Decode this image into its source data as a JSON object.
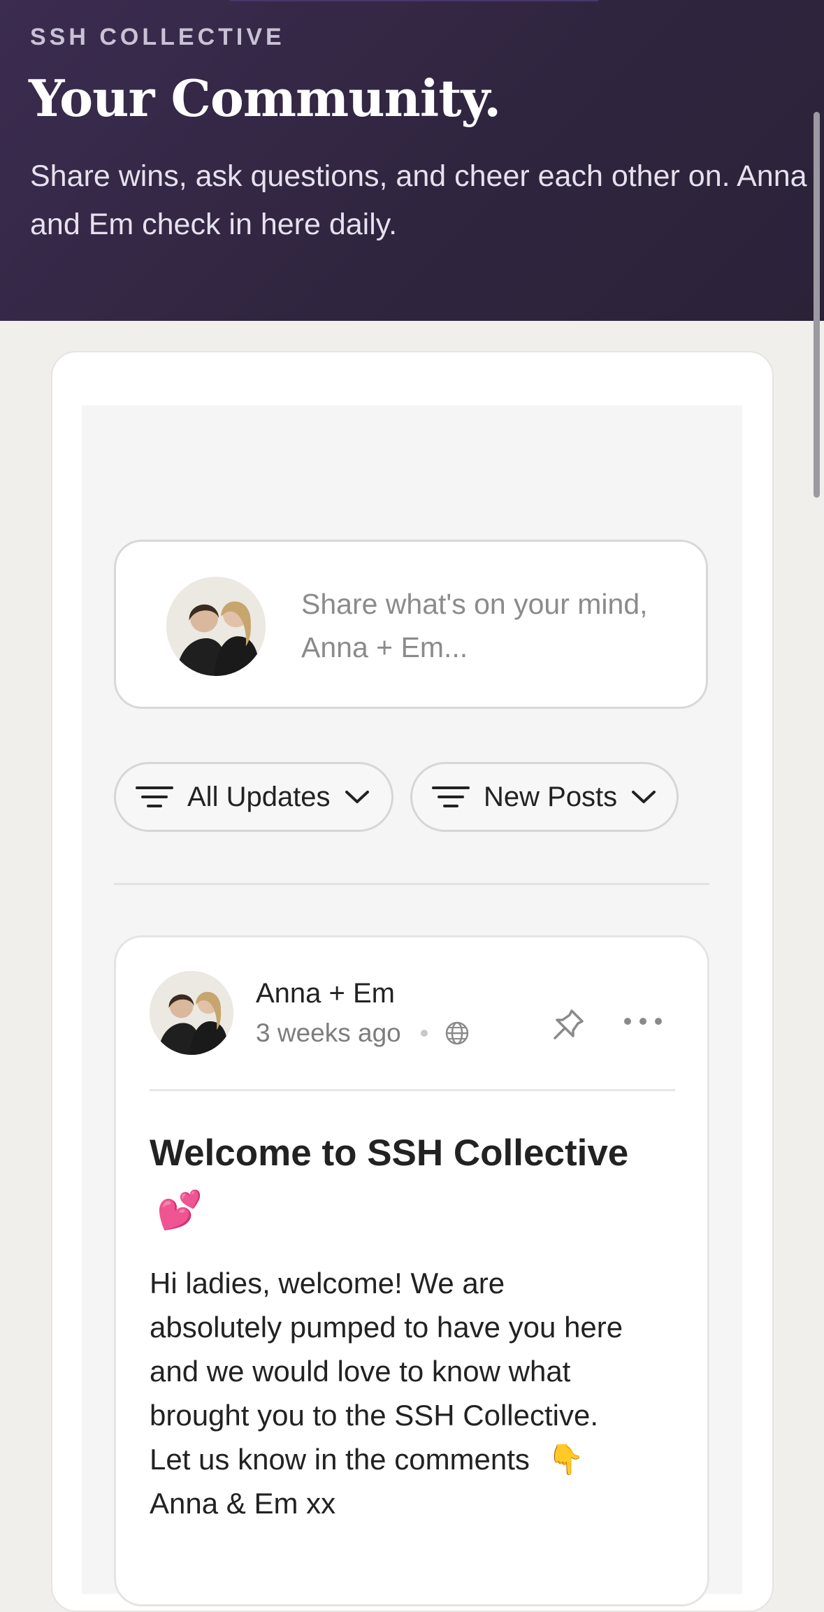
{
  "hero": {
    "eyebrow": "SSH COLLECTIVE",
    "title": "Your Community.",
    "subtitle": "Share wins, ask questions, and cheer each other on. Anna and Em check in here daily."
  },
  "composer": {
    "placeholder": "Share what's on your mind, Anna + Em..."
  },
  "filters": [
    {
      "label": "All Updates",
      "icon": "filter-lines-icon"
    },
    {
      "label": "New Posts",
      "icon": "filter-lines-icon"
    }
  ],
  "post": {
    "author": "Anna + Em",
    "time": "3 weeks ago",
    "visibility_icon": "globe-icon",
    "title": "Welcome to SSH Collective",
    "title_emoji": "💕",
    "body": "Hi ladies, welcome! We are absolutely pumped to have you here and we would love to know what brought you to the SSH Collective. Let us know in the comments",
    "body_emoji": "👇",
    "signoff": "Anna & Em xx"
  },
  "colors": {
    "hero_bg": "#30253f",
    "page_bg": "#f1efeb",
    "feed_bg": "#f5f5f5"
  }
}
